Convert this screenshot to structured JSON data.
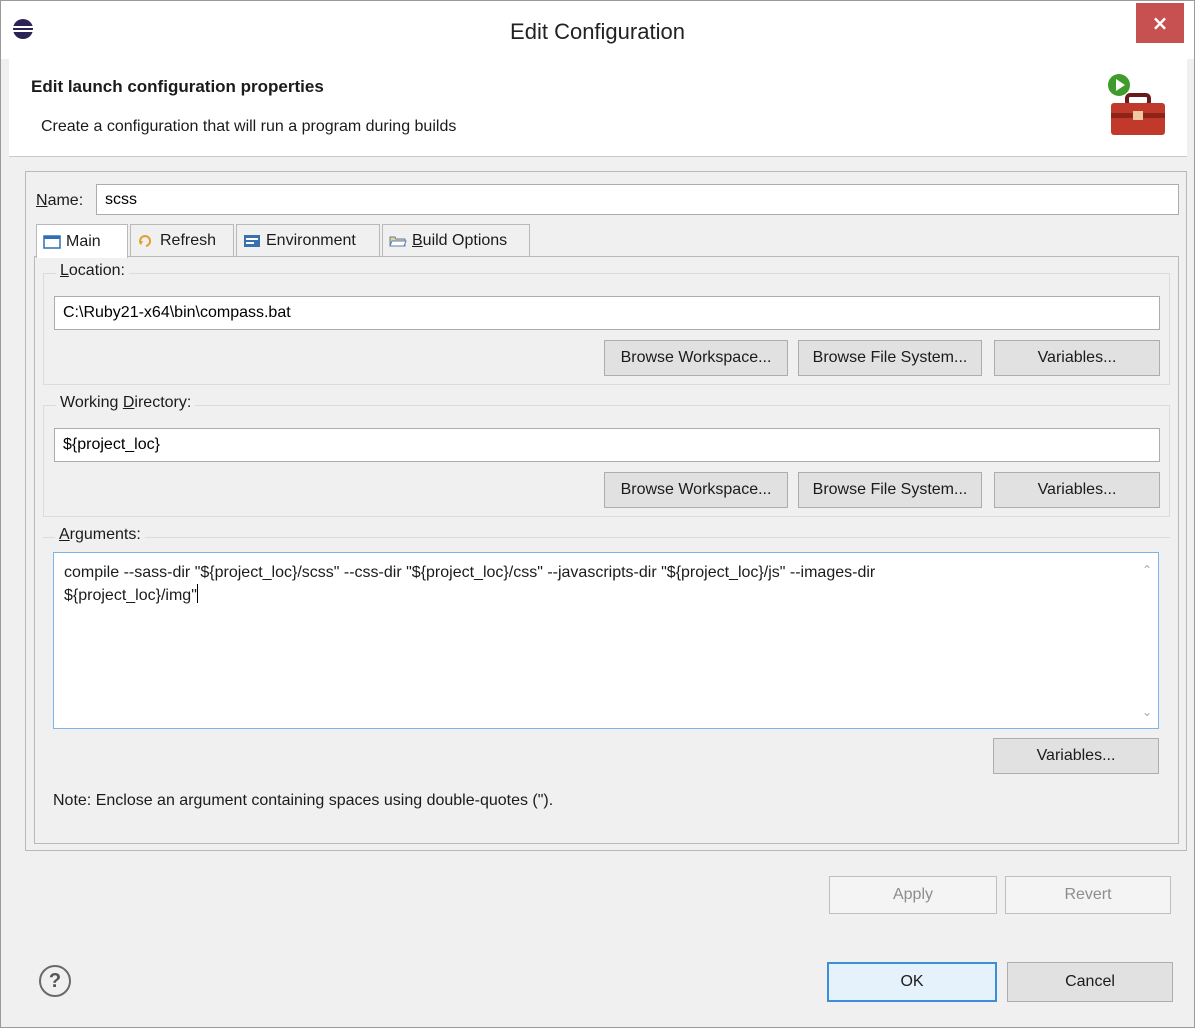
{
  "window": {
    "title": "Edit Configuration",
    "close_glyph": "×"
  },
  "banner": {
    "title": "Edit launch configuration properties",
    "description": "Create a configuration that will run a program during builds",
    "icon": "toolbox-run-icon"
  },
  "name": {
    "label": "Name:",
    "value": "scss"
  },
  "tabs": [
    {
      "label": "Main",
      "icon": "main-tab-icon",
      "active": true
    },
    {
      "label": "Refresh",
      "icon": "refresh-icon",
      "active": false
    },
    {
      "label": "Environment",
      "icon": "environment-icon",
      "active": false
    },
    {
      "label": "Build Options",
      "icon": "folder-open-icon",
      "active": false
    }
  ],
  "location": {
    "label": "Location:",
    "value": "C:\\Ruby21-x64\\bin\\compass.bat",
    "buttons": {
      "workspace": "Browse Workspace...",
      "filesystem": "Browse File System...",
      "variables": "Variables..."
    }
  },
  "working_directory": {
    "label": "Working Directory:",
    "value": "${project_loc}",
    "buttons": {
      "workspace": "Browse Workspace...",
      "filesystem": "Browse File System...",
      "variables": "Variables..."
    }
  },
  "arguments": {
    "label": "Arguments:",
    "value": "compile --sass-dir \"${project_loc}/scss\" --css-dir \"${project_loc}/css\" --javascripts-dir \"${project_loc}/js\" --images-dir\n${project_loc}/img\"",
    "variables_button": "Variables...",
    "note": "Note: Enclose an argument containing spaces using double-quotes (\")."
  },
  "footer": {
    "apply": "Apply",
    "revert": "Revert",
    "ok": "OK",
    "cancel": "Cancel",
    "help_glyph": "?"
  },
  "colors": {
    "close": "#c75050",
    "focus": "#3a8fd8",
    "window_bg": "#f0f0f0"
  }
}
